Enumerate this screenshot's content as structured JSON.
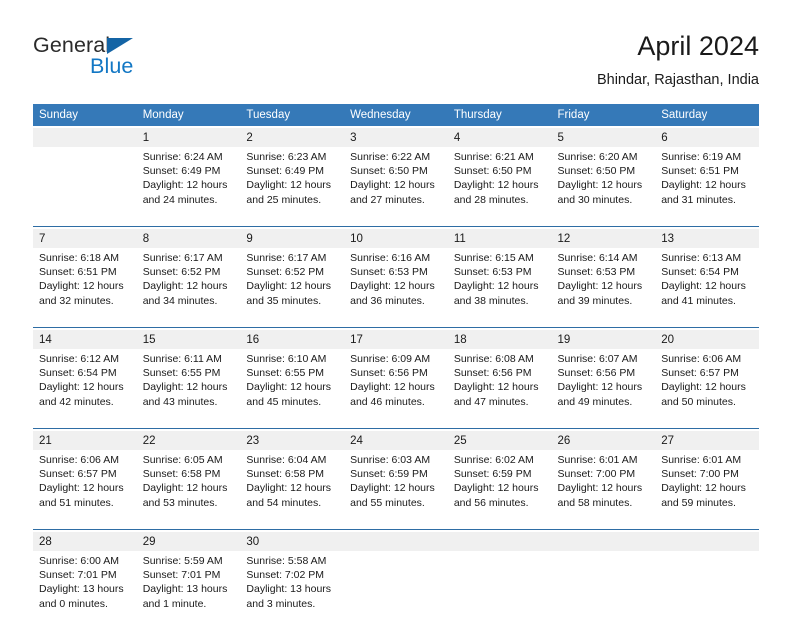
{
  "logo": {
    "word1": "General",
    "word2": "Blue",
    "icon": "triangle-logo-mark",
    "brand_color": "#1277c4",
    "mark_color": "#1464a5"
  },
  "header": {
    "title": "April 2024",
    "location": "Bhindar, Rajasthan, India",
    "header_bg": "#3579b8",
    "divider_color": "#2e6da4",
    "daynum_bg": "#f0f0f0"
  },
  "weekdays": [
    "Sunday",
    "Monday",
    "Tuesday",
    "Wednesday",
    "Thursday",
    "Friday",
    "Saturday"
  ],
  "weeks": [
    [
      {
        "day": "",
        "sunrise": "",
        "sunset": "",
        "daylight_1": "",
        "daylight_2": ""
      },
      {
        "day": "1",
        "sunrise": "Sunrise: 6:24 AM",
        "sunset": "Sunset: 6:49 PM",
        "daylight_1": "Daylight: 12 hours",
        "daylight_2": "and 24 minutes."
      },
      {
        "day": "2",
        "sunrise": "Sunrise: 6:23 AM",
        "sunset": "Sunset: 6:49 PM",
        "daylight_1": "Daylight: 12 hours",
        "daylight_2": "and 25 minutes."
      },
      {
        "day": "3",
        "sunrise": "Sunrise: 6:22 AM",
        "sunset": "Sunset: 6:50 PM",
        "daylight_1": "Daylight: 12 hours",
        "daylight_2": "and 27 minutes."
      },
      {
        "day": "4",
        "sunrise": "Sunrise: 6:21 AM",
        "sunset": "Sunset: 6:50 PM",
        "daylight_1": "Daylight: 12 hours",
        "daylight_2": "and 28 minutes."
      },
      {
        "day": "5",
        "sunrise": "Sunrise: 6:20 AM",
        "sunset": "Sunset: 6:50 PM",
        "daylight_1": "Daylight: 12 hours",
        "daylight_2": "and 30 minutes."
      },
      {
        "day": "6",
        "sunrise": "Sunrise: 6:19 AM",
        "sunset": "Sunset: 6:51 PM",
        "daylight_1": "Daylight: 12 hours",
        "daylight_2": "and 31 minutes."
      }
    ],
    [
      {
        "day": "7",
        "sunrise": "Sunrise: 6:18 AM",
        "sunset": "Sunset: 6:51 PM",
        "daylight_1": "Daylight: 12 hours",
        "daylight_2": "and 32 minutes."
      },
      {
        "day": "8",
        "sunrise": "Sunrise: 6:17 AM",
        "sunset": "Sunset: 6:52 PM",
        "daylight_1": "Daylight: 12 hours",
        "daylight_2": "and 34 minutes."
      },
      {
        "day": "9",
        "sunrise": "Sunrise: 6:17 AM",
        "sunset": "Sunset: 6:52 PM",
        "daylight_1": "Daylight: 12 hours",
        "daylight_2": "and 35 minutes."
      },
      {
        "day": "10",
        "sunrise": "Sunrise: 6:16 AM",
        "sunset": "Sunset: 6:53 PM",
        "daylight_1": "Daylight: 12 hours",
        "daylight_2": "and 36 minutes."
      },
      {
        "day": "11",
        "sunrise": "Sunrise: 6:15 AM",
        "sunset": "Sunset: 6:53 PM",
        "daylight_1": "Daylight: 12 hours",
        "daylight_2": "and 38 minutes."
      },
      {
        "day": "12",
        "sunrise": "Sunrise: 6:14 AM",
        "sunset": "Sunset: 6:53 PM",
        "daylight_1": "Daylight: 12 hours",
        "daylight_2": "and 39 minutes."
      },
      {
        "day": "13",
        "sunrise": "Sunrise: 6:13 AM",
        "sunset": "Sunset: 6:54 PM",
        "daylight_1": "Daylight: 12 hours",
        "daylight_2": "and 41 minutes."
      }
    ],
    [
      {
        "day": "14",
        "sunrise": "Sunrise: 6:12 AM",
        "sunset": "Sunset: 6:54 PM",
        "daylight_1": "Daylight: 12 hours",
        "daylight_2": "and 42 minutes."
      },
      {
        "day": "15",
        "sunrise": "Sunrise: 6:11 AM",
        "sunset": "Sunset: 6:55 PM",
        "daylight_1": "Daylight: 12 hours",
        "daylight_2": "and 43 minutes."
      },
      {
        "day": "16",
        "sunrise": "Sunrise: 6:10 AM",
        "sunset": "Sunset: 6:55 PM",
        "daylight_1": "Daylight: 12 hours",
        "daylight_2": "and 45 minutes."
      },
      {
        "day": "17",
        "sunrise": "Sunrise: 6:09 AM",
        "sunset": "Sunset: 6:56 PM",
        "daylight_1": "Daylight: 12 hours",
        "daylight_2": "and 46 minutes."
      },
      {
        "day": "18",
        "sunrise": "Sunrise: 6:08 AM",
        "sunset": "Sunset: 6:56 PM",
        "daylight_1": "Daylight: 12 hours",
        "daylight_2": "and 47 minutes."
      },
      {
        "day": "19",
        "sunrise": "Sunrise: 6:07 AM",
        "sunset": "Sunset: 6:56 PM",
        "daylight_1": "Daylight: 12 hours",
        "daylight_2": "and 49 minutes."
      },
      {
        "day": "20",
        "sunrise": "Sunrise: 6:06 AM",
        "sunset": "Sunset: 6:57 PM",
        "daylight_1": "Daylight: 12 hours",
        "daylight_2": "and 50 minutes."
      }
    ],
    [
      {
        "day": "21",
        "sunrise": "Sunrise: 6:06 AM",
        "sunset": "Sunset: 6:57 PM",
        "daylight_1": "Daylight: 12 hours",
        "daylight_2": "and 51 minutes."
      },
      {
        "day": "22",
        "sunrise": "Sunrise: 6:05 AM",
        "sunset": "Sunset: 6:58 PM",
        "daylight_1": "Daylight: 12 hours",
        "daylight_2": "and 53 minutes."
      },
      {
        "day": "23",
        "sunrise": "Sunrise: 6:04 AM",
        "sunset": "Sunset: 6:58 PM",
        "daylight_1": "Daylight: 12 hours",
        "daylight_2": "and 54 minutes."
      },
      {
        "day": "24",
        "sunrise": "Sunrise: 6:03 AM",
        "sunset": "Sunset: 6:59 PM",
        "daylight_1": "Daylight: 12 hours",
        "daylight_2": "and 55 minutes."
      },
      {
        "day": "25",
        "sunrise": "Sunrise: 6:02 AM",
        "sunset": "Sunset: 6:59 PM",
        "daylight_1": "Daylight: 12 hours",
        "daylight_2": "and 56 minutes."
      },
      {
        "day": "26",
        "sunrise": "Sunrise: 6:01 AM",
        "sunset": "Sunset: 7:00 PM",
        "daylight_1": "Daylight: 12 hours",
        "daylight_2": "and 58 minutes."
      },
      {
        "day": "27",
        "sunrise": "Sunrise: 6:01 AM",
        "sunset": "Sunset: 7:00 PM",
        "daylight_1": "Daylight: 12 hours",
        "daylight_2": "and 59 minutes."
      }
    ],
    [
      {
        "day": "28",
        "sunrise": "Sunrise: 6:00 AM",
        "sunset": "Sunset: 7:01 PM",
        "daylight_1": "Daylight: 13 hours",
        "daylight_2": "and 0 minutes."
      },
      {
        "day": "29",
        "sunrise": "Sunrise: 5:59 AM",
        "sunset": "Sunset: 7:01 PM",
        "daylight_1": "Daylight: 13 hours",
        "daylight_2": "and 1 minute."
      },
      {
        "day": "30",
        "sunrise": "Sunrise: 5:58 AM",
        "sunset": "Sunset: 7:02 PM",
        "daylight_1": "Daylight: 13 hours",
        "daylight_2": "and 3 minutes."
      },
      {
        "day": "",
        "sunrise": "",
        "sunset": "",
        "daylight_1": "",
        "daylight_2": ""
      },
      {
        "day": "",
        "sunrise": "",
        "sunset": "",
        "daylight_1": "",
        "daylight_2": ""
      },
      {
        "day": "",
        "sunrise": "",
        "sunset": "",
        "daylight_1": "",
        "daylight_2": ""
      },
      {
        "day": "",
        "sunrise": "",
        "sunset": "",
        "daylight_1": "",
        "daylight_2": ""
      }
    ]
  ]
}
